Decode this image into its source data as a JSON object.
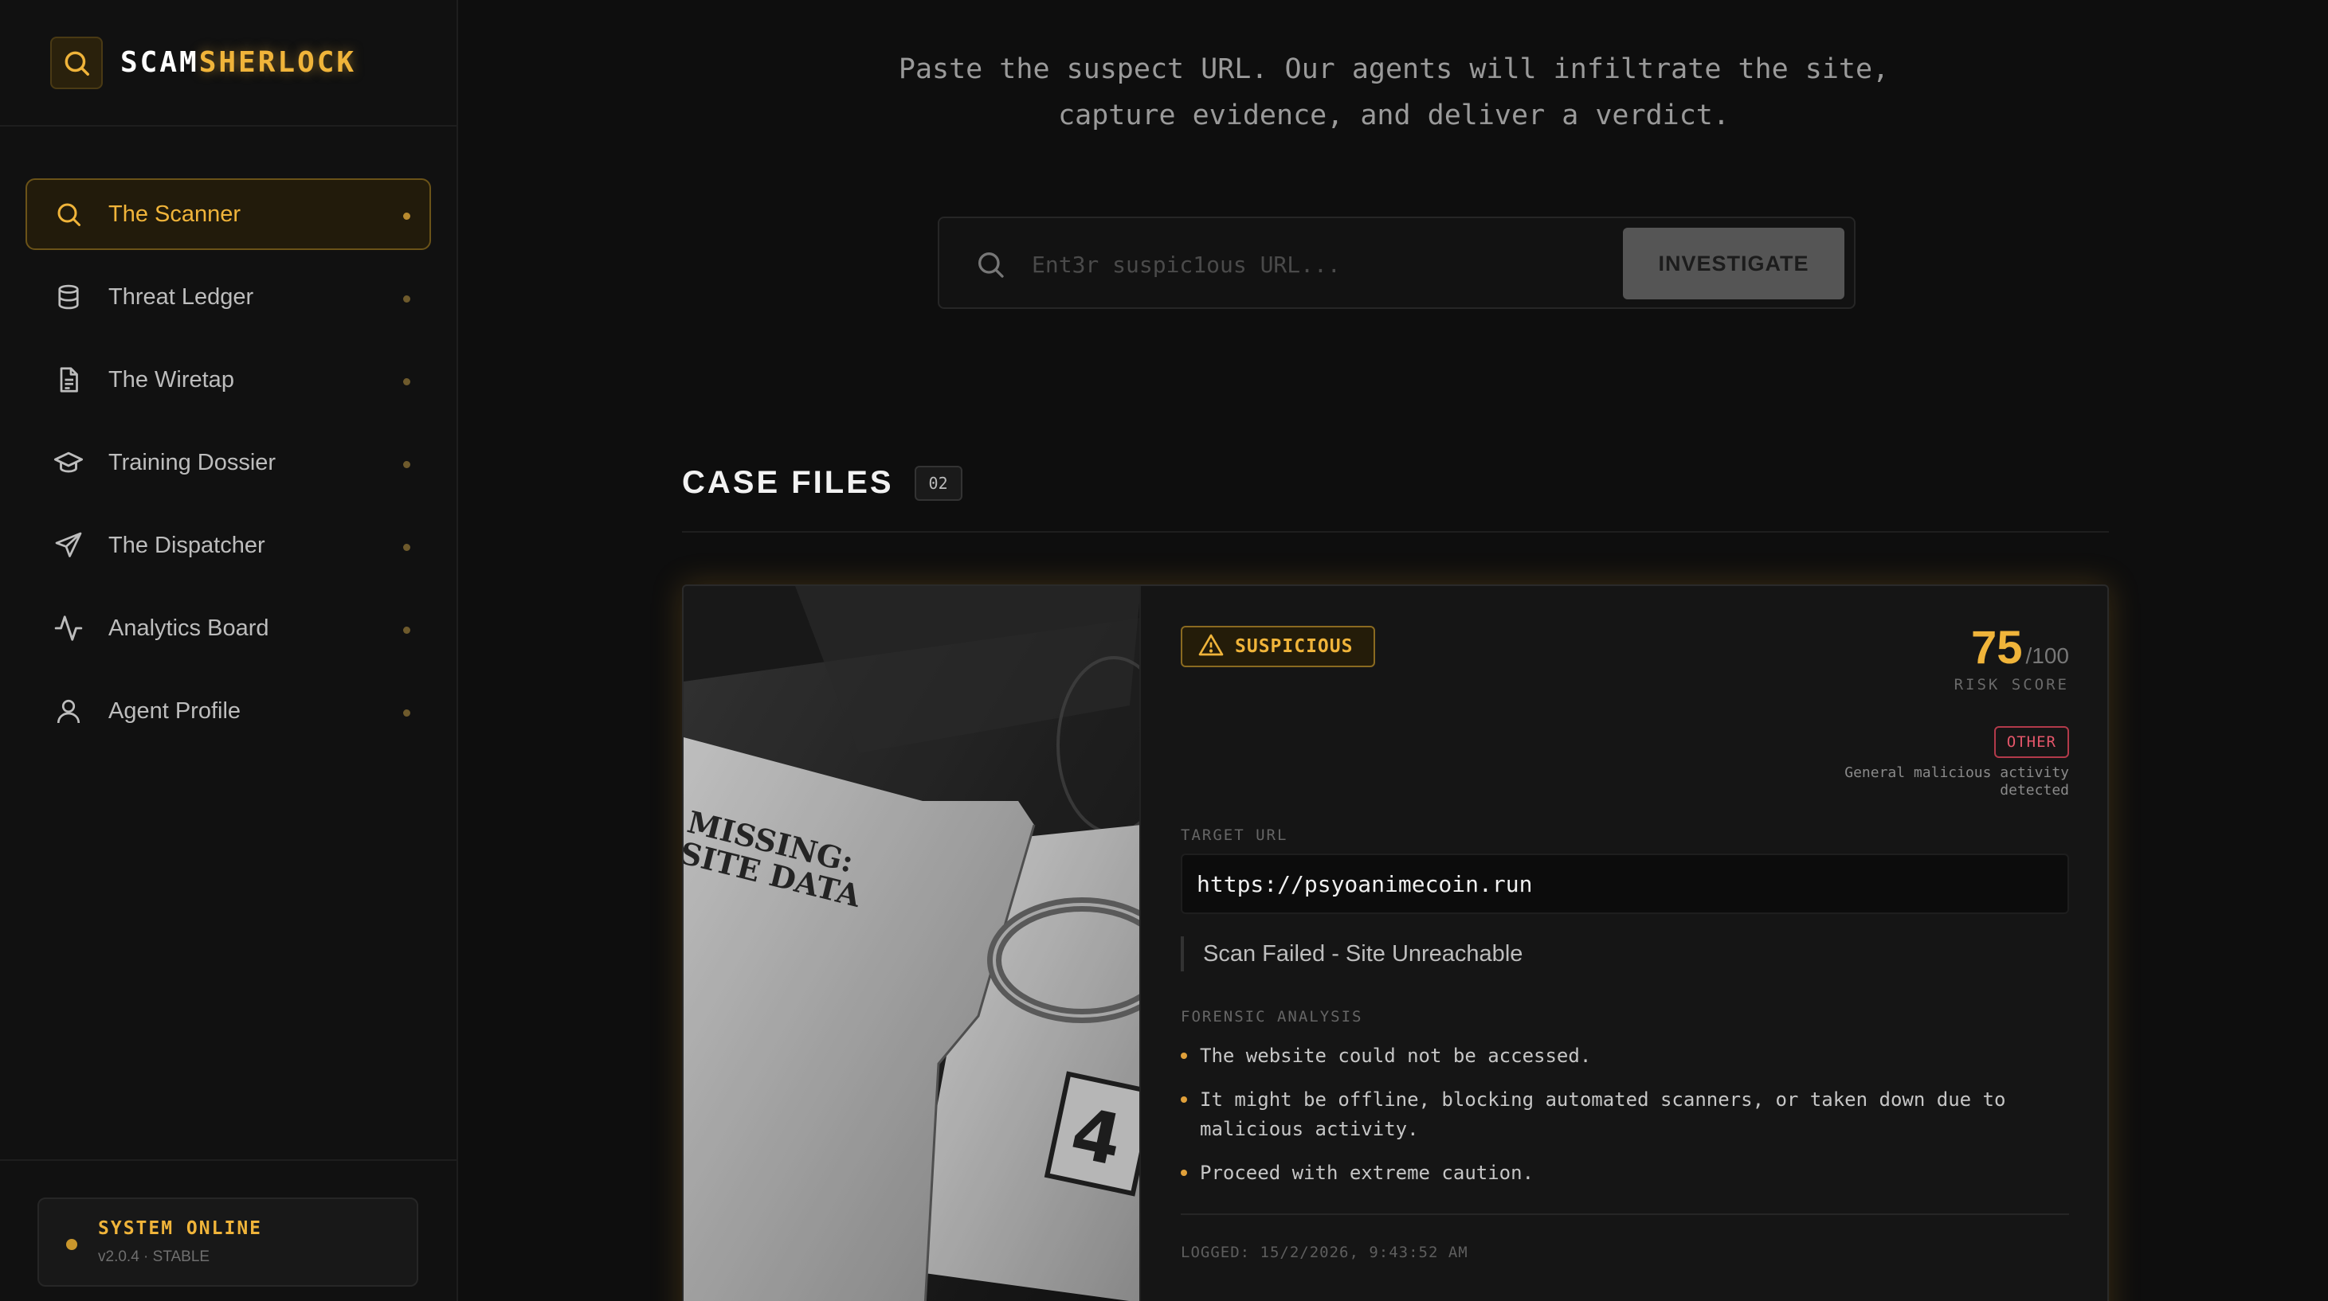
{
  "brand": {
    "name_a": "SCAM",
    "name_b": "SHERLOCK",
    "icon": "search-icon"
  },
  "sidebar": {
    "items": [
      {
        "label": "The Scanner",
        "icon": "search-icon",
        "active": true
      },
      {
        "label": "Threat Ledger",
        "icon": "database-icon",
        "active": false
      },
      {
        "label": "The Wiretap",
        "icon": "document-icon",
        "active": false
      },
      {
        "label": "Training Dossier",
        "icon": "graduation-cap-icon",
        "active": false
      },
      {
        "label": "The Dispatcher",
        "icon": "send-icon",
        "active": false
      },
      {
        "label": "Analytics Board",
        "icon": "activity-icon",
        "active": false
      },
      {
        "label": "Agent Profile",
        "icon": "user-icon",
        "active": false
      }
    ],
    "status": {
      "title": "SYSTEM ONLINE",
      "version": "v2.0.4 · STABLE"
    }
  },
  "scanner": {
    "intro_line1": "Paste the suspect URL. Our agents will infiltrate the site,",
    "intro_line2": "capture evidence, and deliver a verdict.",
    "search_placeholder": "Ent3r suspic1ous URL...",
    "search_value": "",
    "investigate_label": "INVESTIGATE"
  },
  "case_files": {
    "title": "CASE FILES",
    "count": "02",
    "cases": [
      {
        "image_caption": "MISSING: SITE DATA",
        "evidence_number": "4",
        "verdict": "SUSPICIOUS",
        "risk_score": "75",
        "risk_max": "/100",
        "risk_label": "RISK SCORE",
        "category": "OTHER",
        "category_desc": "General malicious activity detected",
        "target_url_label": "TARGET URL",
        "target_url": "https://psyoanimecoin.run",
        "scan_status": "Scan Failed - Site Unreachable",
        "forensic_label": "FORENSIC ANALYSIS",
        "findings": [
          "The website could not be accessed.",
          "It might be offline, blocking automated scanners, or taken down due to malicious activity.",
          "Proceed with extreme caution."
        ],
        "logged": "LOGGED: 15/2/2026, 9:43:52 AM"
      }
    ]
  },
  "colors": {
    "accent": "#f0b43a",
    "background": "#0e0e0e",
    "sidebar": "#111111",
    "danger": "#e4566a"
  }
}
